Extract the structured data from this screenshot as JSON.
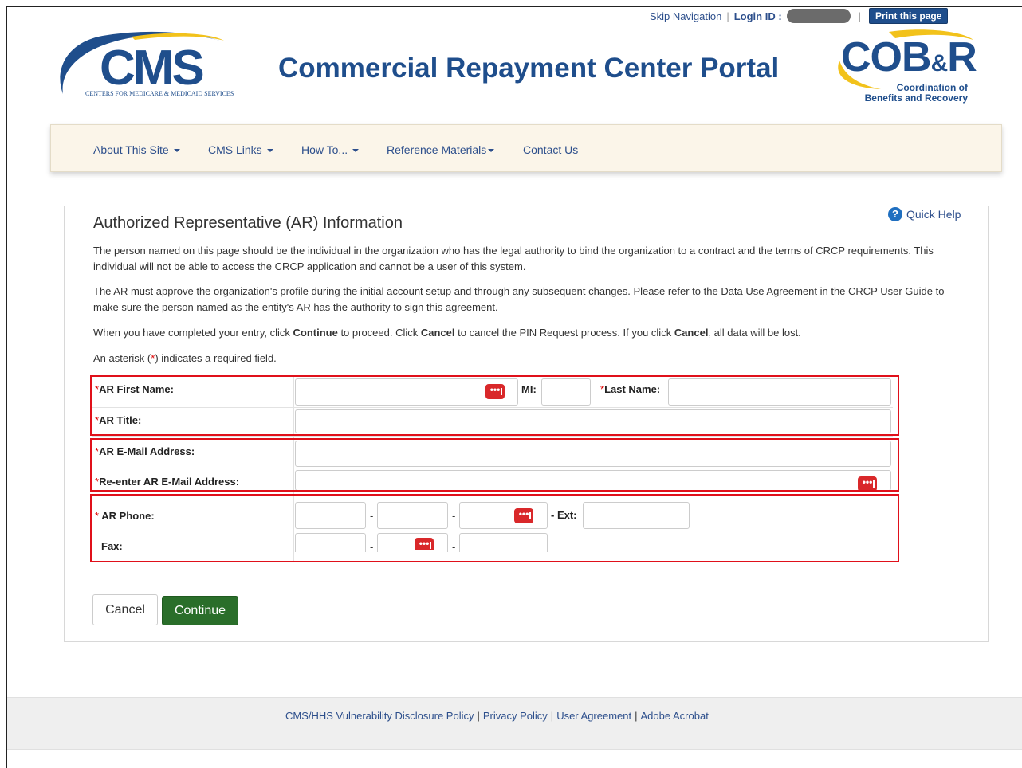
{
  "top": {
    "skip_nav": "Skip Navigation",
    "login_label": "Login ID :",
    "print_label": "Print this page"
  },
  "header": {
    "cms_logo_text": "CMS",
    "cms_logo_sub": "CENTERS FOR MEDICARE & MEDICAID SERVICES",
    "portal_title": "Commercial Repayment Center Portal",
    "cob_logo_text": "COB",
    "cob_logo_amp": "&",
    "cob_logo_r": "R",
    "cob_sub_1": "Coordination of",
    "cob_sub_2": "Benefits and Recovery"
  },
  "nav": {
    "items": [
      {
        "label": "About This Site"
      },
      {
        "label": "CMS Links"
      },
      {
        "label": "How To..."
      },
      {
        "label": "Reference Materials"
      },
      {
        "label": "Contact Us"
      }
    ]
  },
  "main": {
    "quick_help": "Quick Help",
    "heading": "Authorized Representative (AR) Information",
    "para1": "The person named on this page should be the individual in the organization who has the legal authority to bind the organization to a contract and the terms of CRCP requirements. This individual will not be able to access the CRCP application and cannot be a user of this system.",
    "para2": "The AR must approve the organization's profile during the initial account setup and through any subsequent changes. Please refer to the Data Use Agreement in the CRCP User Guide to make sure the person named as the entity's AR has the authority to sign this agreement.",
    "para3_a": "When you have completed your entry, click ",
    "para3_continue": "Continue",
    "para3_b": " to proceed. Click ",
    "para3_cancel": "Cancel",
    "para3_c": " to cancel the PIN Request process. If you click ",
    "para3_cancel2": "Cancel",
    "para3_d": ", all data will be lost.",
    "para4_a": "An asterisk (",
    "para4_star": "*",
    "para4_b": ") indicates a required field."
  },
  "form": {
    "asterisk": "*",
    "first_name_label": "AR First Name:",
    "mi_label": "MI:",
    "last_name_label": "Last Name:",
    "title_label": "AR Title:",
    "email_label": "AR E-Mail Address:",
    "reemail_label": "Re-enter AR E-Mail Address:",
    "phone_label": "AR Phone:",
    "ext_label": "- Ext:",
    "fax_label": "Fax:",
    "dash": "-",
    "dots": "•••"
  },
  "buttons": {
    "cancel": "Cancel",
    "continue": "Continue"
  },
  "footer": {
    "links": [
      "CMS/HHS Vulnerability Disclosure Policy",
      "Privacy Policy",
      "User Agreement",
      "Adobe Acrobat"
    ],
    "sep": "|"
  }
}
